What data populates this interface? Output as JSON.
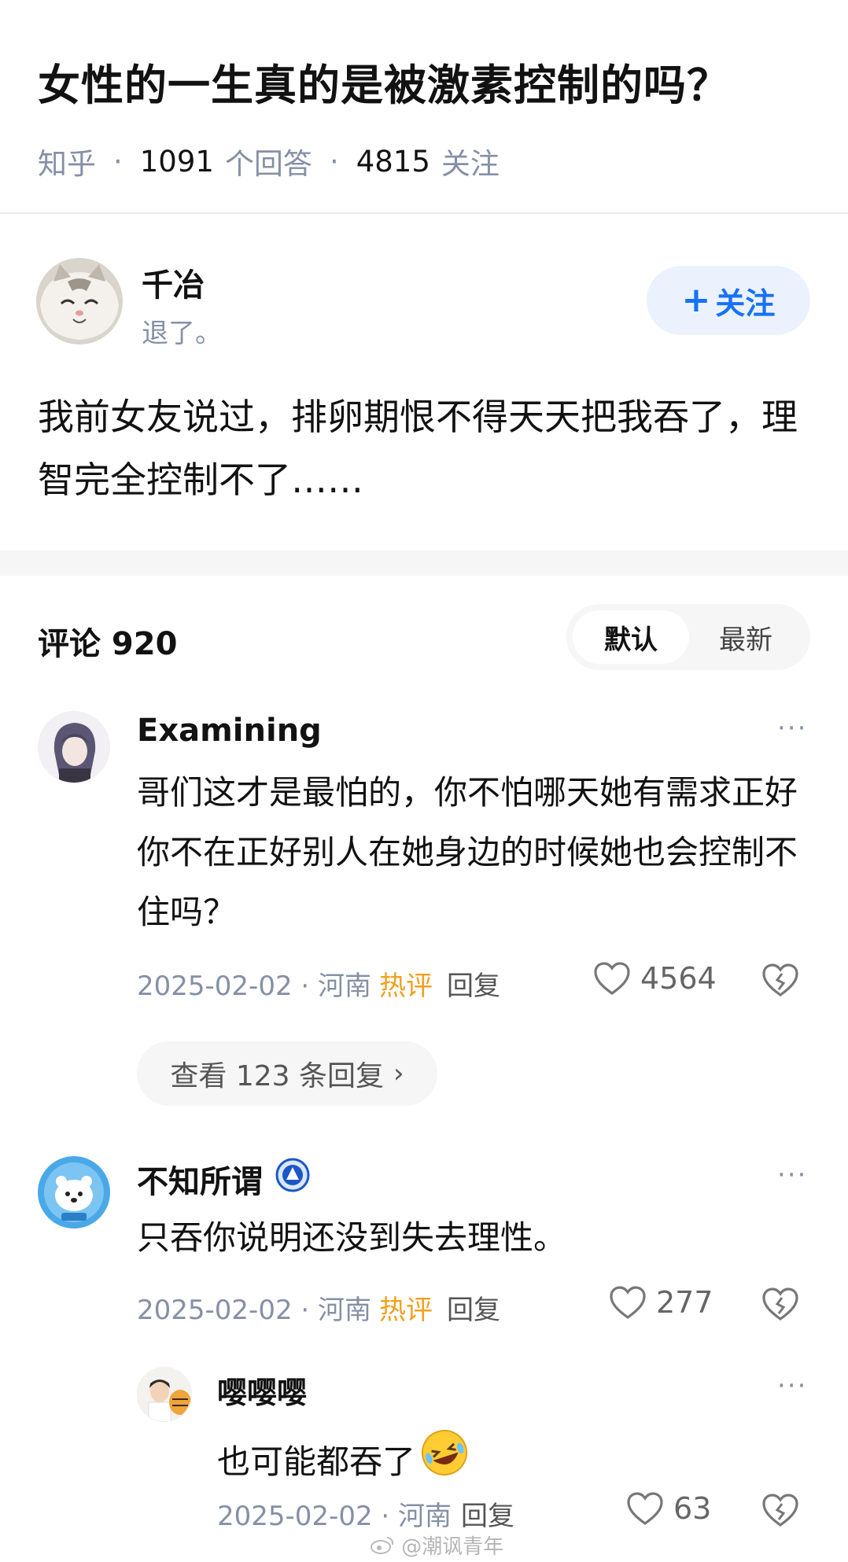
{
  "question": {
    "title": "女性的一生真的是被激素控制的吗？",
    "source": "知乎",
    "answers_count": "1091",
    "answers_label": "个回答",
    "followers_count": "4815",
    "followers_label": "关注"
  },
  "answer": {
    "author_name": "千冶",
    "author_bio": "退了。",
    "follow_label": "关注",
    "text": "我前女友说过，排卵期恨不得天天把我吞了，理智完全控制不了……"
  },
  "comments_header": {
    "title": "评论 920",
    "sort_default": "默认",
    "sort_latest": "最新"
  },
  "comments": [
    {
      "name": "Examining",
      "text": "哥们这才是最怕的，你不怕哪天她有需求正好你不在正好别人在她身边的时候她也会控制不住吗？",
      "date": "2025-02-02 · 河南",
      "hot": "热评",
      "reply": "回复",
      "likes": "4564",
      "view_replies": "查看 123 条回复"
    },
    {
      "name": "不知所谓",
      "text": "只吞你说明还没到失去理性。",
      "date": "2025-02-02 · 河南",
      "hot": "热评",
      "reply": "回复",
      "likes": "277"
    },
    {
      "name": "嘤嘤嘤",
      "text": "也可能都吞了",
      "date": "2025-02-02 · 河南",
      "reply": "回复",
      "likes": "63"
    }
  ],
  "watermark": "@潮讽青年",
  "colors": {
    "accent_blue": "#1772f6",
    "follow_bg": "#ebf2fd",
    "hot_orange": "#f0a020",
    "meta_gray": "#8590a6"
  }
}
